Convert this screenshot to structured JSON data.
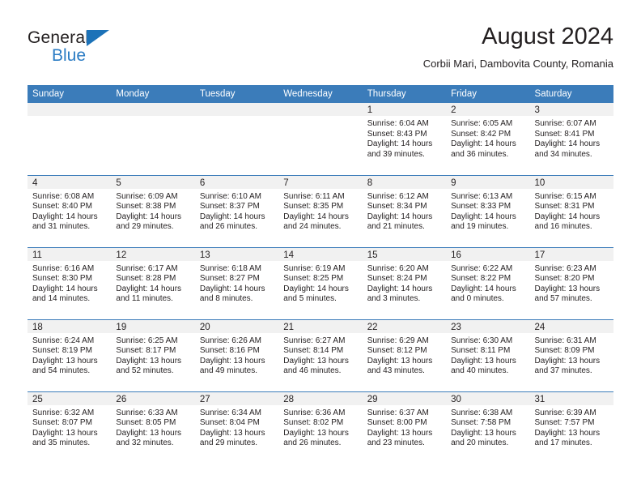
{
  "brand": {
    "name_top": "General",
    "name_bottom": "Blue",
    "triangle_color": "#1c72b8",
    "text_color": "#2b7cc4"
  },
  "header": {
    "title": "August 2024",
    "location": "Corbii Mari, Dambovita County, Romania"
  },
  "theme": {
    "header_blue": "#3b7cba",
    "day_band_gray": "#f1f1f1",
    "text": "#231f20"
  },
  "weekday_headers": [
    "Sunday",
    "Monday",
    "Tuesday",
    "Wednesday",
    "Thursday",
    "Friday",
    "Saturday"
  ],
  "weeks": [
    [
      {
        "day": ""
      },
      {
        "day": ""
      },
      {
        "day": ""
      },
      {
        "day": ""
      },
      {
        "day": "1",
        "sunrise": "Sunrise: 6:04 AM",
        "sunset": "Sunset: 8:43 PM",
        "daylight1": "Daylight: 14 hours",
        "daylight2": "and 39 minutes."
      },
      {
        "day": "2",
        "sunrise": "Sunrise: 6:05 AM",
        "sunset": "Sunset: 8:42 PM",
        "daylight1": "Daylight: 14 hours",
        "daylight2": "and 36 minutes."
      },
      {
        "day": "3",
        "sunrise": "Sunrise: 6:07 AM",
        "sunset": "Sunset: 8:41 PM",
        "daylight1": "Daylight: 14 hours",
        "daylight2": "and 34 minutes."
      }
    ],
    [
      {
        "day": "4",
        "sunrise": "Sunrise: 6:08 AM",
        "sunset": "Sunset: 8:40 PM",
        "daylight1": "Daylight: 14 hours",
        "daylight2": "and 31 minutes."
      },
      {
        "day": "5",
        "sunrise": "Sunrise: 6:09 AM",
        "sunset": "Sunset: 8:38 PM",
        "daylight1": "Daylight: 14 hours",
        "daylight2": "and 29 minutes."
      },
      {
        "day": "6",
        "sunrise": "Sunrise: 6:10 AM",
        "sunset": "Sunset: 8:37 PM",
        "daylight1": "Daylight: 14 hours",
        "daylight2": "and 26 minutes."
      },
      {
        "day": "7",
        "sunrise": "Sunrise: 6:11 AM",
        "sunset": "Sunset: 8:35 PM",
        "daylight1": "Daylight: 14 hours",
        "daylight2": "and 24 minutes."
      },
      {
        "day": "8",
        "sunrise": "Sunrise: 6:12 AM",
        "sunset": "Sunset: 8:34 PM",
        "daylight1": "Daylight: 14 hours",
        "daylight2": "and 21 minutes."
      },
      {
        "day": "9",
        "sunrise": "Sunrise: 6:13 AM",
        "sunset": "Sunset: 8:33 PM",
        "daylight1": "Daylight: 14 hours",
        "daylight2": "and 19 minutes."
      },
      {
        "day": "10",
        "sunrise": "Sunrise: 6:15 AM",
        "sunset": "Sunset: 8:31 PM",
        "daylight1": "Daylight: 14 hours",
        "daylight2": "and 16 minutes."
      }
    ],
    [
      {
        "day": "11",
        "sunrise": "Sunrise: 6:16 AM",
        "sunset": "Sunset: 8:30 PM",
        "daylight1": "Daylight: 14 hours",
        "daylight2": "and 14 minutes."
      },
      {
        "day": "12",
        "sunrise": "Sunrise: 6:17 AM",
        "sunset": "Sunset: 8:28 PM",
        "daylight1": "Daylight: 14 hours",
        "daylight2": "and 11 minutes."
      },
      {
        "day": "13",
        "sunrise": "Sunrise: 6:18 AM",
        "sunset": "Sunset: 8:27 PM",
        "daylight1": "Daylight: 14 hours",
        "daylight2": "and 8 minutes."
      },
      {
        "day": "14",
        "sunrise": "Sunrise: 6:19 AM",
        "sunset": "Sunset: 8:25 PM",
        "daylight1": "Daylight: 14 hours",
        "daylight2": "and 5 minutes."
      },
      {
        "day": "15",
        "sunrise": "Sunrise: 6:20 AM",
        "sunset": "Sunset: 8:24 PM",
        "daylight1": "Daylight: 14 hours",
        "daylight2": "and 3 minutes."
      },
      {
        "day": "16",
        "sunrise": "Sunrise: 6:22 AM",
        "sunset": "Sunset: 8:22 PM",
        "daylight1": "Daylight: 14 hours",
        "daylight2": "and 0 minutes."
      },
      {
        "day": "17",
        "sunrise": "Sunrise: 6:23 AM",
        "sunset": "Sunset: 8:20 PM",
        "daylight1": "Daylight: 13 hours",
        "daylight2": "and 57 minutes."
      }
    ],
    [
      {
        "day": "18",
        "sunrise": "Sunrise: 6:24 AM",
        "sunset": "Sunset: 8:19 PM",
        "daylight1": "Daylight: 13 hours",
        "daylight2": "and 54 minutes."
      },
      {
        "day": "19",
        "sunrise": "Sunrise: 6:25 AM",
        "sunset": "Sunset: 8:17 PM",
        "daylight1": "Daylight: 13 hours",
        "daylight2": "and 52 minutes."
      },
      {
        "day": "20",
        "sunrise": "Sunrise: 6:26 AM",
        "sunset": "Sunset: 8:16 PM",
        "daylight1": "Daylight: 13 hours",
        "daylight2": "and 49 minutes."
      },
      {
        "day": "21",
        "sunrise": "Sunrise: 6:27 AM",
        "sunset": "Sunset: 8:14 PM",
        "daylight1": "Daylight: 13 hours",
        "daylight2": "and 46 minutes."
      },
      {
        "day": "22",
        "sunrise": "Sunrise: 6:29 AM",
        "sunset": "Sunset: 8:12 PM",
        "daylight1": "Daylight: 13 hours",
        "daylight2": "and 43 minutes."
      },
      {
        "day": "23",
        "sunrise": "Sunrise: 6:30 AM",
        "sunset": "Sunset: 8:11 PM",
        "daylight1": "Daylight: 13 hours",
        "daylight2": "and 40 minutes."
      },
      {
        "day": "24",
        "sunrise": "Sunrise: 6:31 AM",
        "sunset": "Sunset: 8:09 PM",
        "daylight1": "Daylight: 13 hours",
        "daylight2": "and 37 minutes."
      }
    ],
    [
      {
        "day": "25",
        "sunrise": "Sunrise: 6:32 AM",
        "sunset": "Sunset: 8:07 PM",
        "daylight1": "Daylight: 13 hours",
        "daylight2": "and 35 minutes."
      },
      {
        "day": "26",
        "sunrise": "Sunrise: 6:33 AM",
        "sunset": "Sunset: 8:05 PM",
        "daylight1": "Daylight: 13 hours",
        "daylight2": "and 32 minutes."
      },
      {
        "day": "27",
        "sunrise": "Sunrise: 6:34 AM",
        "sunset": "Sunset: 8:04 PM",
        "daylight1": "Daylight: 13 hours",
        "daylight2": "and 29 minutes."
      },
      {
        "day": "28",
        "sunrise": "Sunrise: 6:36 AM",
        "sunset": "Sunset: 8:02 PM",
        "daylight1": "Daylight: 13 hours",
        "daylight2": "and 26 minutes."
      },
      {
        "day": "29",
        "sunrise": "Sunrise: 6:37 AM",
        "sunset": "Sunset: 8:00 PM",
        "daylight1": "Daylight: 13 hours",
        "daylight2": "and 23 minutes."
      },
      {
        "day": "30",
        "sunrise": "Sunrise: 6:38 AM",
        "sunset": "Sunset: 7:58 PM",
        "daylight1": "Daylight: 13 hours",
        "daylight2": "and 20 minutes."
      },
      {
        "day": "31",
        "sunrise": "Sunrise: 6:39 AM",
        "sunset": "Sunset: 7:57 PM",
        "daylight1": "Daylight: 13 hours",
        "daylight2": "and 17 minutes."
      }
    ]
  ]
}
